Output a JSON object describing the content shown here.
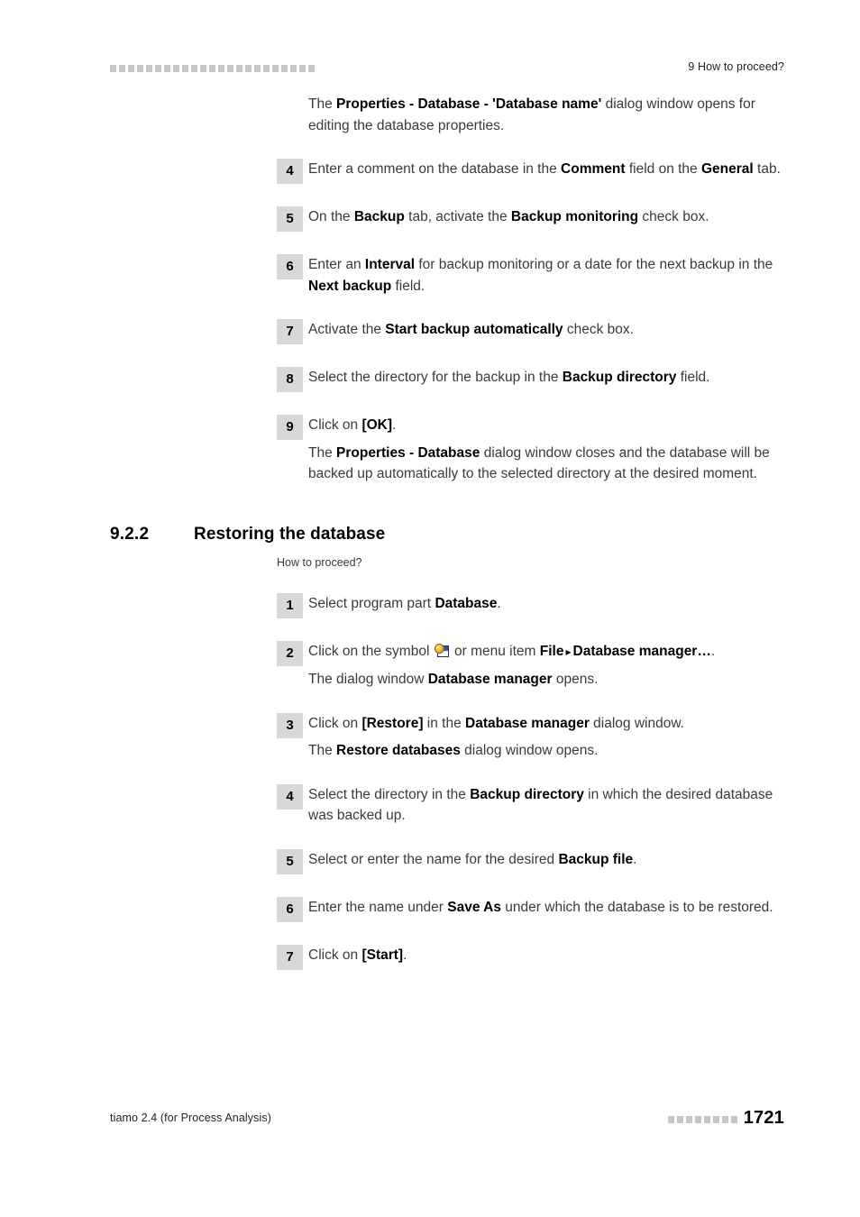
{
  "header": {
    "decoration_squares": 23,
    "right_text": "9 How to proceed?"
  },
  "intro": {
    "prefix": "The ",
    "bold": "Properties - Database - 'Database name'",
    "suffix": " dialog window opens for editing the database properties."
  },
  "steps_backup": [
    {
      "number": "4",
      "parts": [
        {
          "text": "Enter a comment on the database in the ",
          "bold": false
        },
        {
          "text": "Comment",
          "bold": true
        },
        {
          "text": " field on the ",
          "bold": false
        },
        {
          "text": "General",
          "bold": true
        },
        {
          "text": " tab.",
          "bold": false
        }
      ]
    },
    {
      "number": "5",
      "parts": [
        {
          "text": "On the ",
          "bold": false
        },
        {
          "text": "Backup",
          "bold": true
        },
        {
          "text": " tab, activate the ",
          "bold": false
        },
        {
          "text": "Backup monitoring",
          "bold": true
        },
        {
          "text": " check box.",
          "bold": false
        }
      ]
    },
    {
      "number": "6",
      "parts": [
        {
          "text": "Enter an ",
          "bold": false
        },
        {
          "text": "Interval",
          "bold": true
        },
        {
          "text": " for backup monitoring or a date for the next backup in the ",
          "bold": false
        },
        {
          "text": "Next backup",
          "bold": true
        },
        {
          "text": " field.",
          "bold": false
        }
      ]
    },
    {
      "number": "7",
      "parts": [
        {
          "text": "Activate the ",
          "bold": false
        },
        {
          "text": "Start backup automatically",
          "bold": true
        },
        {
          "text": " check box.",
          "bold": false
        }
      ]
    },
    {
      "number": "8",
      "parts": [
        {
          "text": "Select the directory for the backup in the ",
          "bold": false
        },
        {
          "text": "Backup directory",
          "bold": true
        },
        {
          "text": " field.",
          "bold": false
        }
      ]
    },
    {
      "number": "9",
      "parts": [
        {
          "text": "Click on ",
          "bold": false
        },
        {
          "text": "[OK]",
          "bold": true
        },
        {
          "text": ".",
          "bold": false
        }
      ],
      "continuation": [
        {
          "text": "The ",
          "bold": false
        },
        {
          "text": "Properties - Database",
          "bold": true
        },
        {
          "text": " dialog window closes and the database will be backed up automatically to the selected directory at the desired moment.",
          "bold": false
        }
      ]
    }
  ],
  "section": {
    "number": "9.2.2",
    "title": "Restoring the database",
    "subtitle": "How to proceed?"
  },
  "steps_restore": [
    {
      "number": "1",
      "parts": [
        {
          "text": "Select program part ",
          "bold": false
        },
        {
          "text": "Database",
          "bold": true
        },
        {
          "text": ".",
          "bold": false
        }
      ]
    },
    {
      "number": "2",
      "parts": [
        {
          "text": "Click on the symbol ",
          "bold": false
        },
        {
          "icon": "database-manager-icon"
        },
        {
          "text": " or menu item ",
          "bold": false
        },
        {
          "text": "File",
          "bold": true
        },
        {
          "arrow": "▸"
        },
        {
          "text": "Database manager…",
          "bold": true
        },
        {
          "text": ".",
          "bold": false
        }
      ],
      "continuation": [
        {
          "text": "The dialog window ",
          "bold": false
        },
        {
          "text": "Database manager",
          "bold": true
        },
        {
          "text": " opens.",
          "bold": false
        }
      ]
    },
    {
      "number": "3",
      "parts": [
        {
          "text": "Click on ",
          "bold": false
        },
        {
          "text": "[Restore]",
          "bold": true
        },
        {
          "text": " in the ",
          "bold": false
        },
        {
          "text": "Database manager",
          "bold": true
        },
        {
          "text": " dialog window.",
          "bold": false
        }
      ],
      "continuation": [
        {
          "text": "The ",
          "bold": false
        },
        {
          "text": "Restore databases",
          "bold": true
        },
        {
          "text": " dialog window opens.",
          "bold": false
        }
      ]
    },
    {
      "number": "4",
      "parts": [
        {
          "text": "Select the directory in the ",
          "bold": false
        },
        {
          "text": "Backup directory",
          "bold": true
        },
        {
          "text": " in which the desired database was backed up.",
          "bold": false
        }
      ]
    },
    {
      "number": "5",
      "parts": [
        {
          "text": "Select or enter the name for the desired ",
          "bold": false
        },
        {
          "text": "Backup file",
          "bold": true
        },
        {
          "text": ".",
          "bold": false
        }
      ]
    },
    {
      "number": "6",
      "parts": [
        {
          "text": "Enter the name under ",
          "bold": false
        },
        {
          "text": "Save As",
          "bold": true
        },
        {
          "text": " under which the database is to be restored.",
          "bold": false
        }
      ]
    },
    {
      "number": "7",
      "parts": [
        {
          "text": "Click on ",
          "bold": false
        },
        {
          "text": "[Start]",
          "bold": true
        },
        {
          "text": ".",
          "bold": false
        }
      ]
    }
  ],
  "footer": {
    "left_text": "tiamo 2.4 (for Process Analysis)",
    "decoration_squares": 8,
    "page_number": "1721"
  },
  "colors": {
    "step_box": "#d8d8d8",
    "decoration": "#c6c6c6",
    "body_text": "#3a3a3c",
    "bold_text": "#000000"
  }
}
